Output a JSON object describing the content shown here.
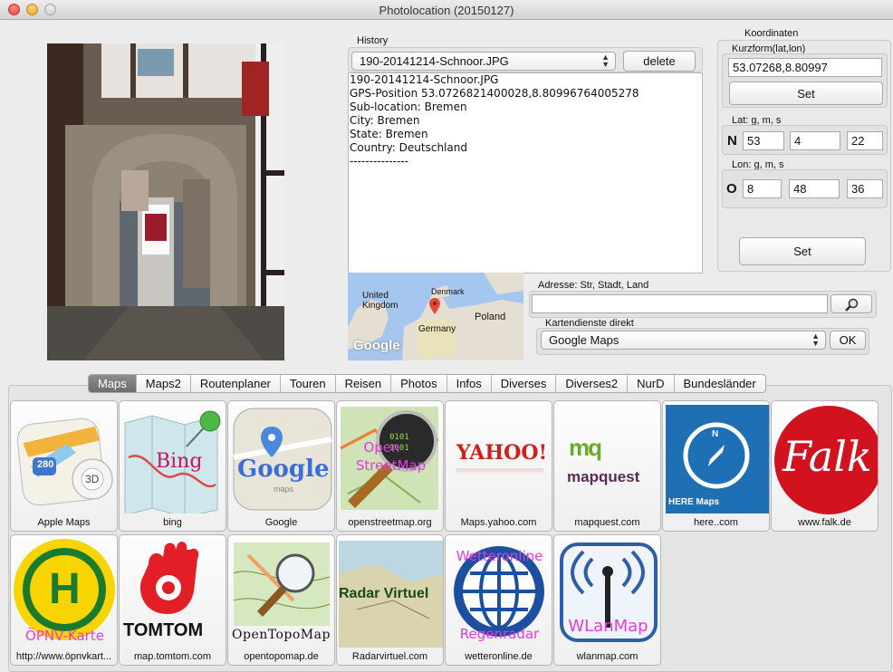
{
  "window": {
    "title": "Photolocation (20150127)"
  },
  "history": {
    "label": "History",
    "selected_file": "190-20141214-Schnoor.JPG",
    "delete_label": "delete",
    "lines": [
      "190-20141214-Schnoor.JPG",
      "GPS-Position 53.0726821400028,8.80996764005278",
      "Sub-location: Bremen",
      "City: Bremen",
      "State: Bremen",
      "Country: Deutschland",
      "---------------"
    ]
  },
  "map": {
    "labels": [
      "Denmark",
      "United Kingdom",
      "Poland",
      "Germany"
    ],
    "logo": "Google"
  },
  "coords": {
    "group_label": "Koordinaten",
    "short_label": "Kurzform(lat,lon)",
    "short_value": "53.07268,8.80997",
    "set_label": "Set",
    "lat_label": "Lat: g, m, s",
    "lat_dir": "N",
    "lat_g": "53",
    "lat_m": "4",
    "lat_s": "22",
    "lon_label": "Lon: g, m, s",
    "lon_dir": "O",
    "lon_g": "8",
    "lon_m": "48",
    "lon_s": "36",
    "set2_label": "Set"
  },
  "address": {
    "label": "Adresse: Str, Stadt, Land",
    "value": ""
  },
  "services": {
    "label": "Kartendienste direkt",
    "selected": "Google Maps",
    "ok_label": "OK"
  },
  "tabs": [
    "Maps",
    "Maps2",
    "Routenplaner",
    "Touren",
    "Reisen",
    "Photos",
    "Infos",
    "Diverses",
    "Diverses2",
    "NurD",
    "Bundesländer"
  ],
  "tiles_row1": [
    {
      "caption": "Apple Maps",
      "icon": "apple-maps-icon",
      "shield": "280",
      "btn": "3D"
    },
    {
      "caption": "bing",
      "icon": "bing-maps-icon",
      "overlay": "Bing"
    },
    {
      "caption": "Google",
      "icon": "google-maps-icon",
      "logo": "Google",
      "sub": "maps"
    },
    {
      "caption": "openstreetmap.org",
      "icon": "openstreetmap-icon",
      "overlay1": "Open",
      "overlay2": "StreetMap"
    },
    {
      "caption": "Maps.yahoo.com",
      "icon": "yahoo-icon",
      "logo": "YAHOO!"
    },
    {
      "caption": "mapquest.com",
      "icon": "mapquest-icon",
      "logo": "mapquest",
      "mark": "mq"
    },
    {
      "caption": "here..com",
      "icon": "here-maps-icon",
      "logo": "HERE Maps",
      "n": "N"
    },
    {
      "caption": "www.falk.de",
      "icon": "falk-icon",
      "logo": "Falk"
    }
  ],
  "tiles_row2": [
    {
      "caption": "http://www.öpnvkart...",
      "icon": "oepnv-icon",
      "letter": "H",
      "overlay": "ÖPNV-Karte"
    },
    {
      "caption": "map.tomtom.com",
      "icon": "tomtom-icon",
      "logo": "TOMTOM"
    },
    {
      "caption": "opentopomap.de",
      "icon": "opentopomap-icon",
      "logo": "OpenTopoMap"
    },
    {
      "caption": "Radarvirtuel.com",
      "icon": "radarvirtuel-icon",
      "logo": "Radar Virtuel"
    },
    {
      "caption": "wetteronline.de",
      "icon": "wetteronline-icon",
      "overlay1": "Wetteronline",
      "overlay2": "Regenradar"
    },
    {
      "caption": "wlanmap.com",
      "icon": "wlanmap-icon",
      "overlay": "WLanMap"
    }
  ],
  "colors": {
    "falk_red": "#d2121f",
    "here_blue": "#1f6fb5",
    "tab_active": "#7a7a7a",
    "overlay_pink": "#e23be0"
  }
}
